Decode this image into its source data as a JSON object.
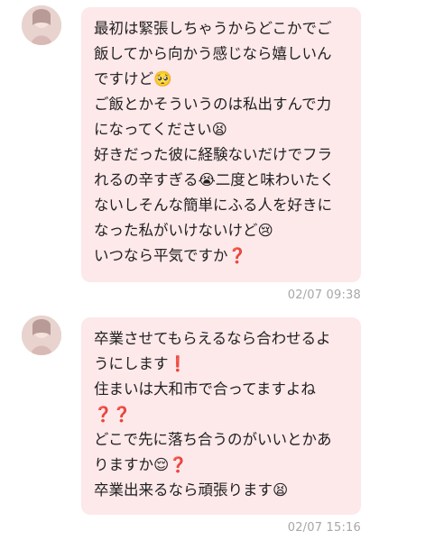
{
  "messages": [
    {
      "lines": [
        "最初は緊張しちゃうからどこかでご",
        "飯してから向かう感じなら嬉しいん",
        "ですけど🥺",
        "ご飯とかそういうのは私出すんで力",
        "になってください😫",
        "好きだった彼に経験ないだけでフラ",
        "れるの辛すぎる😭二度と味わいたく",
        "ないしそんな簡単にふる人を好きに",
        "なった私がいけないけど😢",
        "いつなら平気ですか❓"
      ],
      "timestamp": "02/07 09:38"
    },
    {
      "lines": [
        "卒業させてもらえるなら合わせるよ",
        "うにします❗",
        "住まいは大和市で合ってますよね",
        "❓❓",
        "どこで先に落ち合うのがいいとかあ",
        "りますか😌❓",
        "卒業出来るなら頑張ります😫"
      ],
      "timestamp": "02/07 15:16"
    }
  ]
}
